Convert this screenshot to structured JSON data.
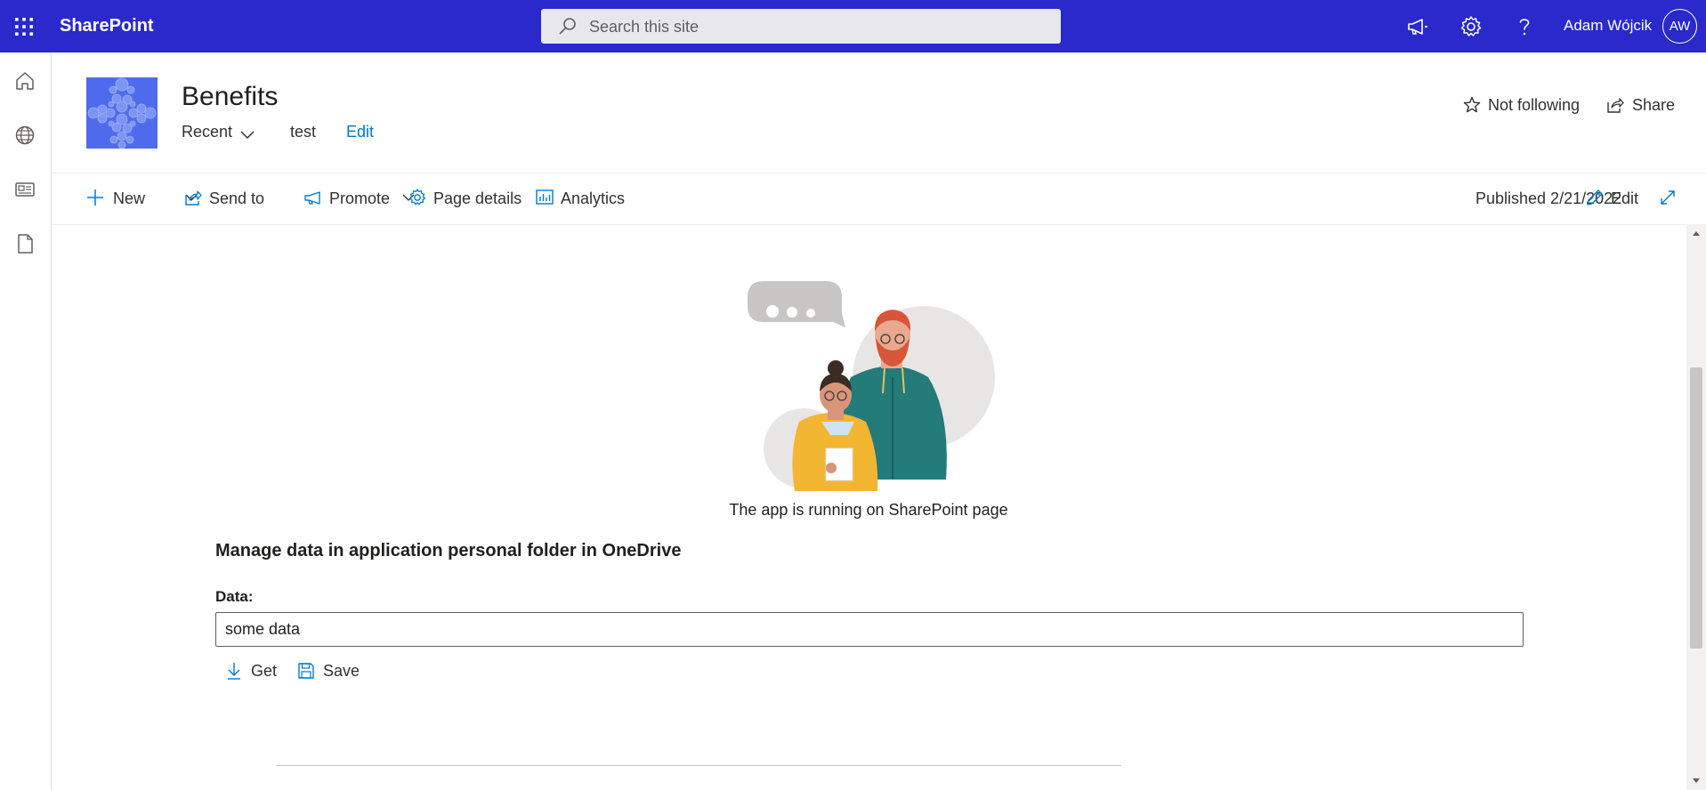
{
  "suite": {
    "brand": "SharePoint",
    "search_placeholder": "Search this site",
    "user_name": "Adam Wójcik",
    "user_initials": "AW",
    "bar_color": "#2929cc"
  },
  "left_rail": {
    "icons": [
      "home-icon",
      "globe-icon",
      "news-icon",
      "page-icon"
    ]
  },
  "site": {
    "title": "Benefits",
    "nav": {
      "recent": "Recent",
      "test": "test",
      "edit": "Edit"
    },
    "follow_label": "Not following",
    "share_label": "Share"
  },
  "command_bar": {
    "new": "New",
    "send_to": "Send to",
    "promote": "Promote",
    "page_details": "Page details",
    "analytics": "Analytics",
    "published": "Published 2/21/2022",
    "edit": "Edit"
  },
  "content": {
    "running_text": "The app is running on SharePoint page",
    "heading": "Manage data in application personal folder in OneDrive",
    "data_label": "Data:",
    "data_value": "some data",
    "get_label": "Get",
    "save_label": "Save"
  }
}
